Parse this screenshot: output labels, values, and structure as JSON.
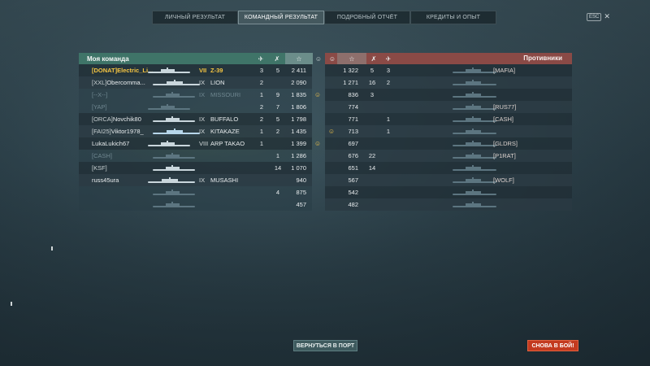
{
  "tabs": [
    {
      "label": "ЛИЧНЫЙ РЕЗУЛЬТАТ",
      "active": false
    },
    {
      "label": "КОМАНДНЫЙ РЕЗУЛЬТАТ",
      "active": true
    },
    {
      "label": "ПОДРОБНЫЙ ОТЧЁТ",
      "active": false
    },
    {
      "label": "КРЕДИТЫ И ОПЫТ",
      "active": false
    }
  ],
  "esc": {
    "key": "ESC",
    "close": "✕"
  },
  "my_team": {
    "title": "Моя команда",
    "col_icons": [
      "plane-icon",
      "crossed-swords-icon",
      "star-icon",
      "smiley-icon"
    ],
    "header_glyphs": {
      "plane": "✈",
      "kills": "✗",
      "star": "☆",
      "smile": "☺"
    },
    "players": [
      {
        "clan": "[DONAT]",
        "name": "Electric_Li...",
        "tier": "VII",
        "ship": "Z-39",
        "planes": "3",
        "kills": "5",
        "exp": "2 411",
        "smiley": "",
        "highlight": true
      },
      {
        "clan": "[XXL]",
        "name": "Obercomma...",
        "tier": "IX",
        "ship": "LION",
        "planes": "2",
        "kills": "",
        "exp": "2 090",
        "smiley": ""
      },
      {
        "clan": "[--X--]",
        "name": "",
        "tier": "IX",
        "ship": "MISSOURI",
        "planes": "1",
        "kills": "9",
        "exp": "1 835",
        "smiley": "☺",
        "dim": true
      },
      {
        "clan": "[YAP]",
        "name": "",
        "tier": "",
        "ship": "",
        "planes": "2",
        "kills": "7",
        "exp": "1 806",
        "smiley": "",
        "dim": true
      },
      {
        "clan": "[ORCA]",
        "name": "Novchik80",
        "tier": "IX",
        "ship": "BUFFALO",
        "planes": "2",
        "kills": "5",
        "exp": "1 798",
        "smiley": ""
      },
      {
        "clan": "[FAI25]",
        "name": "Viktor1978_",
        "tier": "IX",
        "ship": "KITAKAZE",
        "planes": "1",
        "kills": "2",
        "exp": "1 435",
        "smiley": ""
      },
      {
        "clan": "",
        "name": "LukaLukich67",
        "tier": "VIII",
        "ship": "ARP TAKAO",
        "planes": "1",
        "kills": "",
        "exp": "1 399",
        "smiley": "☺"
      },
      {
        "clan": "[CASH]",
        "name": "",
        "tier": "",
        "ship": "",
        "planes": "",
        "kills": "1",
        "exp": "1 286",
        "smiley": "",
        "dim": true
      },
      {
        "clan": "[KSF]",
        "name": "",
        "tier": "",
        "ship": "",
        "planes": "",
        "kills": "14",
        "exp": "1 070",
        "smiley": ""
      },
      {
        "clan": "",
        "name": "russ45ura",
        "tier": "IX",
        "ship": "MUSASHI",
        "planes": "",
        "kills": "",
        "exp": "940",
        "smiley": ""
      },
      {
        "clan": "",
        "name": "",
        "tier": "",
        "ship": "",
        "planes": "",
        "kills": "4",
        "exp": "875",
        "smiley": "",
        "dim": true
      },
      {
        "clan": "",
        "name": "",
        "tier": "",
        "ship": "",
        "planes": "",
        "kills": "",
        "exp": "457",
        "smiley": "",
        "dim": true
      }
    ]
  },
  "enemies": {
    "title": "Противники",
    "players": [
      {
        "smiley": "",
        "exp": "1 322",
        "kills": "5",
        "planes": "3",
        "clan": "[MAFIA]"
      },
      {
        "smiley": "",
        "exp": "1 271",
        "kills": "16",
        "planes": "2",
        "clan": ""
      },
      {
        "smiley": "",
        "exp": "836",
        "kills": "3",
        "planes": "",
        "clan": ""
      },
      {
        "smiley": "",
        "exp": "774",
        "kills": "",
        "planes": "",
        "clan": "[RUS77]"
      },
      {
        "smiley": "",
        "exp": "771",
        "kills": "",
        "planes": "1",
        "clan": "[CASH]"
      },
      {
        "smiley": "☺",
        "exp": "713",
        "kills": "",
        "planes": "1",
        "clan": ""
      },
      {
        "smiley": "",
        "exp": "697",
        "kills": "",
        "planes": "",
        "clan": "[GLDRS]"
      },
      {
        "smiley": "",
        "exp": "676",
        "kills": "22",
        "planes": "",
        "clan": "[P1RAT]"
      },
      {
        "smiley": "",
        "exp": "651",
        "kills": "14",
        "planes": "",
        "clan": ""
      },
      {
        "smiley": "",
        "exp": "567",
        "kills": "",
        "planes": "",
        "clan": "[WOLF]"
      },
      {
        "smiley": "",
        "exp": "542",
        "kills": "",
        "planes": "",
        "clan": ""
      },
      {
        "smiley": "",
        "exp": "482",
        "kills": "",
        "planes": "",
        "clan": ""
      }
    ]
  },
  "buttons": {
    "port": "ВЕРНУТЬСЯ В ПОРТ",
    "battle": "СНОВА В БОЙ!"
  },
  "colors": {
    "my_team": "#3f7468",
    "enemies": "#8a4a46",
    "highlight": "#f5c542",
    "battle_button": "#c33a1f"
  }
}
